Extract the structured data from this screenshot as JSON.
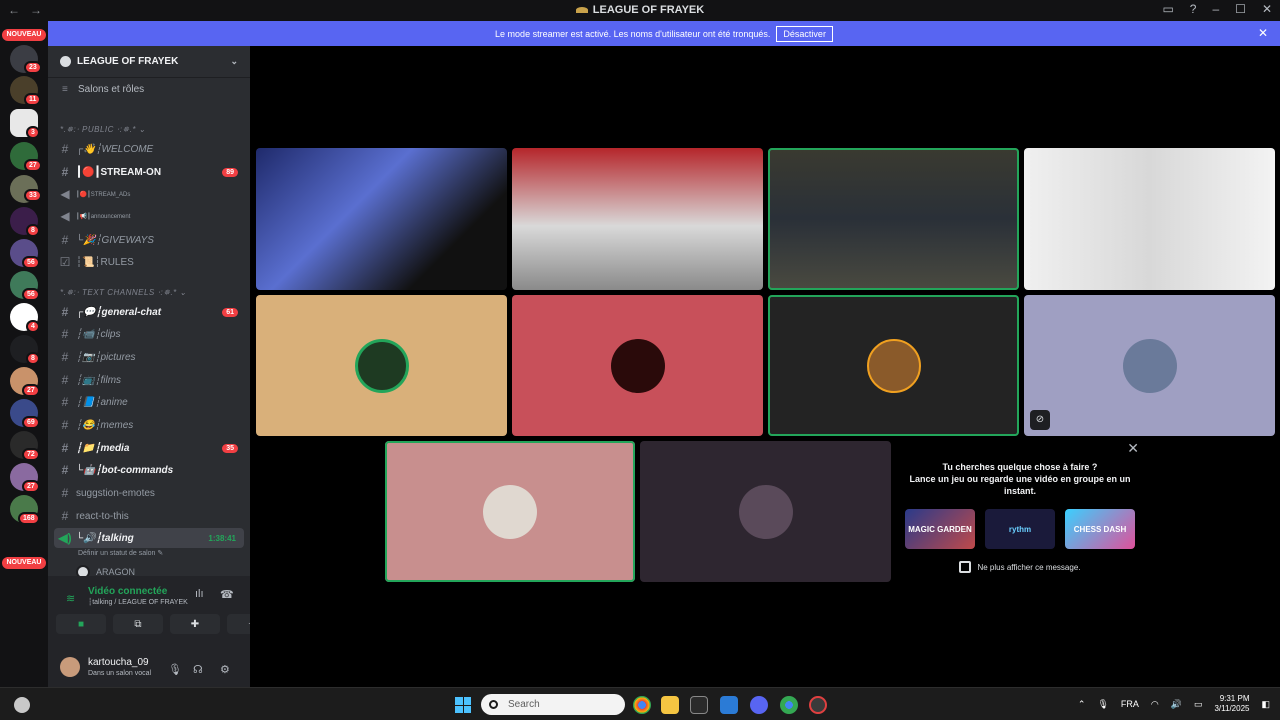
{
  "window": {
    "title": "LEAGUE OF FRAYEK",
    "back_icon": "arrow-left-icon",
    "forward_icon": "arrow-right-icon"
  },
  "banner": {
    "text": "Le mode streamer est activé. Les noms d'utilisateur ont été tronqués.",
    "button": "Désactiver"
  },
  "guilds": {
    "nouveau_label": "NOUVEAU",
    "badges": [
      "23",
      "11",
      "3",
      "27",
      "33",
      "8",
      "56",
      "56",
      "4",
      "8",
      "27",
      "69",
      "72",
      "27",
      "168"
    ]
  },
  "server": {
    "name": "LEAGUE OF FRAYEK",
    "channels_and_roles": "Salons et rôles",
    "categories": [
      "*.✵:‧ PUBLIC ‧:✵.* ⌄",
      "*.✵:‧ TEXT CHANNELS ‧:✵.* ⌄"
    ],
    "channels": [
      {
        "name": "┌👋┆WELCOME",
        "mention": ""
      },
      {
        "name": "┃🔴┃STREAM-ON",
        "mention": "89"
      },
      {
        "name": "┃🔴┃STREAM_ADs",
        "mention": ""
      },
      {
        "name": "┃📢┃announcement",
        "mention": ""
      },
      {
        "name": "└🎉┆GIVEWAYS",
        "mention": ""
      },
      {
        "name": "┆📜┆RULES",
        "mention": ""
      },
      {
        "name": "┌💬┆general-chat",
        "mention": "61"
      },
      {
        "name": "┆📹┆clips",
        "mention": ""
      },
      {
        "name": "┆📷┆pictures",
        "mention": ""
      },
      {
        "name": "┆📺┆films",
        "mention": ""
      },
      {
        "name": "┆📘┆anime",
        "mention": ""
      },
      {
        "name": "┆😂┆memes",
        "mention": ""
      },
      {
        "name": "┆📁┆media",
        "mention": "35"
      },
      {
        "name": "└🤖┆bot-commands",
        "mention": ""
      },
      {
        "name": "suggstion-emotes",
        "mention": ""
      },
      {
        "name": "react-to-this",
        "mention": ""
      }
    ],
    "voice_channel": {
      "name": "└🔊┆talking",
      "timer": "1:38:41",
      "status_placeholder": "Définir un statut de salon ✎",
      "member": "ARAGON"
    }
  },
  "voice_panel": {
    "title": "Vidéo connectée",
    "subtitle": "┆talking / LEAGUE OF FRAYEK"
  },
  "user": {
    "name": "kartoucha_09",
    "status": "Dans un salon vocal"
  },
  "activity": {
    "title_line1": "Tu cherches quelque chose à faire ?",
    "title_line2": "Lance un jeu ou regarde une vidéo en groupe en un instant.",
    "games": [
      "MAGIC GARDEN",
      "rythm",
      "CHESS DASH"
    ],
    "checkbox_label": "Ne plus afficher ce message."
  },
  "taskbar": {
    "search_placeholder": "Search",
    "lang": "FRA",
    "time": "9:31 PM",
    "date": "3/11/2025"
  },
  "colors": {
    "accent": "#5865f2",
    "speaking": "#23a55a",
    "mention": "#f23f43",
    "sidebar": "#2b2d31"
  }
}
